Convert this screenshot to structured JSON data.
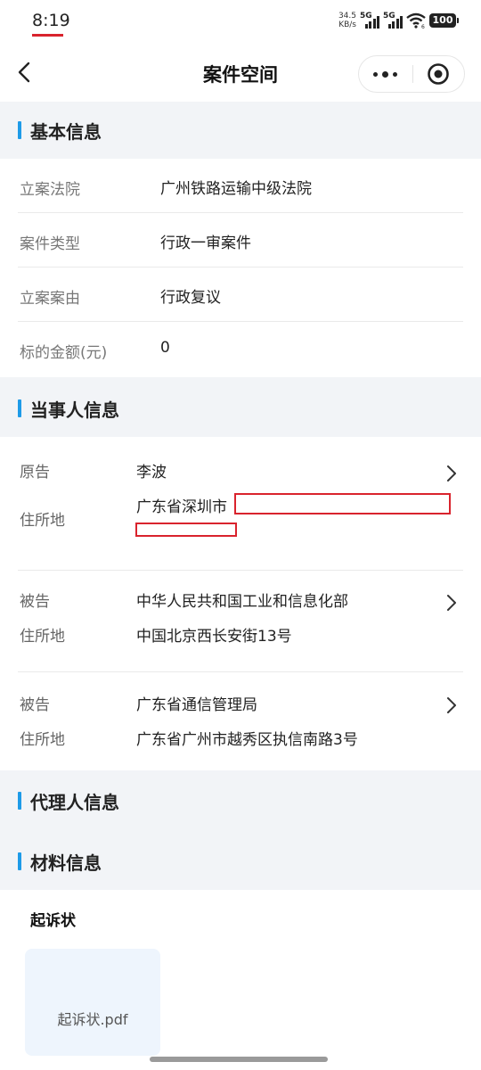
{
  "status": {
    "time": "8:19",
    "net_speed_value": "34.5",
    "net_speed_unit": "KB/s",
    "sim1": "5G",
    "sim2": "5G",
    "wifi_sub": "6",
    "battery": "100"
  },
  "nav": {
    "title": "案件空间",
    "back_icon": "chevron-left-icon",
    "more_icon": "more-dots-icon",
    "target_icon": "target-icon"
  },
  "basic": {
    "section_title": "基本信息",
    "rows": [
      {
        "label": "立案法院",
        "value": "广州铁路运输中级法院"
      },
      {
        "label": "案件类型",
        "value": "行政一审案件"
      },
      {
        "label": "立案案由",
        "value": "行政复议"
      },
      {
        "label": "标的金额(元)",
        "value": "0"
      }
    ]
  },
  "parties": {
    "section_title": "当事人信息",
    "items": [
      {
        "role_label": "原告",
        "name": "李波",
        "address_label": "住所地",
        "address": "广东省深圳市"
      },
      {
        "role_label": "被告",
        "name": "中华人民共和国工业和信息化部",
        "address_label": "住所地",
        "address": "中国北京西长安街13号"
      },
      {
        "role_label": "被告",
        "name": "广东省通信管理局",
        "address_label": "住所地",
        "address": "广东省广州市越秀区执信南路3号"
      }
    ]
  },
  "agents": {
    "section_title": "代理人信息"
  },
  "materials": {
    "section_title": "材料信息",
    "group_title": "起诉状",
    "file_name": "起诉状.pdf"
  },
  "colors": {
    "accent": "#1e9be8",
    "redaction": "#d9232d",
    "page_bg": "#f2f4f7"
  }
}
